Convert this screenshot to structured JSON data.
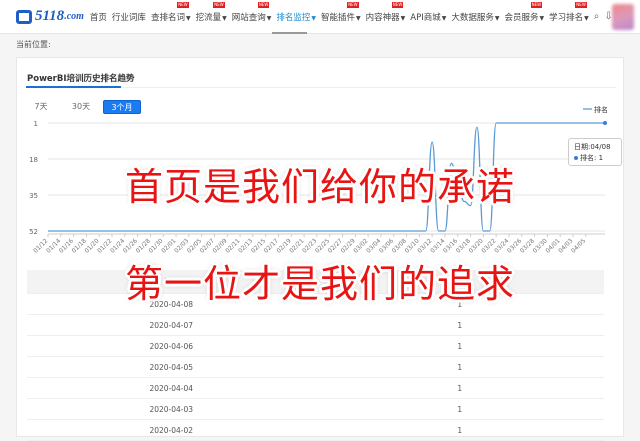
{
  "nav": {
    "logo_text": "5118",
    "logo_suffix": ".com",
    "items": [
      {
        "label": "首页",
        "hot": false,
        "caret": false
      },
      {
        "label": "行业词库",
        "hot": false,
        "caret": false
      },
      {
        "label": "查排名词",
        "hot": true,
        "caret": true
      },
      {
        "label": "挖流量",
        "hot": true,
        "caret": true
      },
      {
        "label": "网站查询",
        "hot": true,
        "caret": true
      },
      {
        "label": "排名监控",
        "hot": false,
        "caret": true,
        "active": true
      },
      {
        "label": "智能插件",
        "hot": true,
        "caret": true
      },
      {
        "label": "内容神器",
        "hot": true,
        "caret": true
      },
      {
        "label": "API商城",
        "hot": false,
        "caret": true
      },
      {
        "label": "大数据服务",
        "hot": false,
        "caret": true
      },
      {
        "label": "会员服务",
        "hot": true,
        "caret": true
      },
      {
        "label": "学习排名",
        "hot": true,
        "caret": true
      }
    ],
    "hot_badge": "NEW",
    "icons": [
      "search-icon",
      "download-icon"
    ]
  },
  "breadcrumb": "当前位置:",
  "card": {
    "title": "PowerBI培训历史排名趋势",
    "ranges": [
      {
        "label": "7天",
        "selected": false
      },
      {
        "label": "30天",
        "selected": false
      },
      {
        "label": "3个月",
        "selected": true
      }
    ]
  },
  "chart_data": {
    "type": "line",
    "legend": [
      "排名"
    ],
    "legend_placement": "top-right",
    "y_reversed": true,
    "ylim": [
      1,
      52
    ],
    "yticks": [
      "1",
      "18",
      "35",
      "52"
    ],
    "xtick_labels": [
      "01/12",
      "01/14",
      "01/16",
      "01/18",
      "01/20",
      "01/22",
      "01/24",
      "01/26",
      "01/28",
      "01/30",
      "02/01",
      "02/03",
      "02/05",
      "02/07",
      "02/09",
      "02/11",
      "02/13",
      "02/15",
      "02/17",
      "02/19",
      "02/21",
      "02/23",
      "02/25",
      "02/27",
      "02/29",
      "03/02",
      "03/04",
      "03/06",
      "03/08",
      "03/10",
      "03/12",
      "03/14",
      "03/16",
      "03/18",
      "03/20",
      "03/22",
      "03/24",
      "03/26",
      "03/28",
      "03/30",
      "04/01",
      "04/03",
      "04/05"
    ],
    "color": "#5a9bd5",
    "series": [
      {
        "name": "排名",
        "x_start": "01/12",
        "x_end": "04/08",
        "values": [
          52,
          52,
          52,
          52,
          52,
          52,
          52,
          52,
          52,
          52,
          52,
          52,
          52,
          52,
          52,
          52,
          52,
          52,
          52,
          52,
          52,
          52,
          52,
          52,
          52,
          52,
          52,
          52,
          52,
          52,
          52,
          52,
          52,
          52,
          52,
          52,
          52,
          52,
          52,
          52,
          52,
          52,
          52,
          52,
          52,
          52,
          52,
          52,
          52,
          52,
          52,
          52,
          52,
          52,
          52,
          52,
          52,
          52,
          52,
          52,
          10,
          52,
          52,
          20,
          30,
          38,
          40,
          3,
          52,
          52,
          1,
          1,
          1,
          1,
          1,
          1,
          1,
          1,
          1,
          1,
          1,
          1,
          1,
          1,
          1,
          1,
          1,
          1
        ]
      }
    ],
    "tooltip": {
      "date_label": "日期:04/08",
      "value_label": "排名: 1"
    }
  },
  "table": {
    "headers": [
      "日期",
      "排名"
    ],
    "rows": [
      [
        "2020-04-08",
        "1"
      ],
      [
        "2020-04-07",
        "1"
      ],
      [
        "2020-04-06",
        "1"
      ],
      [
        "2020-04-05",
        "1"
      ],
      [
        "2020-04-04",
        "1"
      ],
      [
        "2020-04-03",
        "1"
      ],
      [
        "2020-04-02",
        "1"
      ]
    ]
  },
  "overlay": {
    "line1": "首页是我们给你的承诺",
    "line2": "第一位才是我们的追求"
  }
}
